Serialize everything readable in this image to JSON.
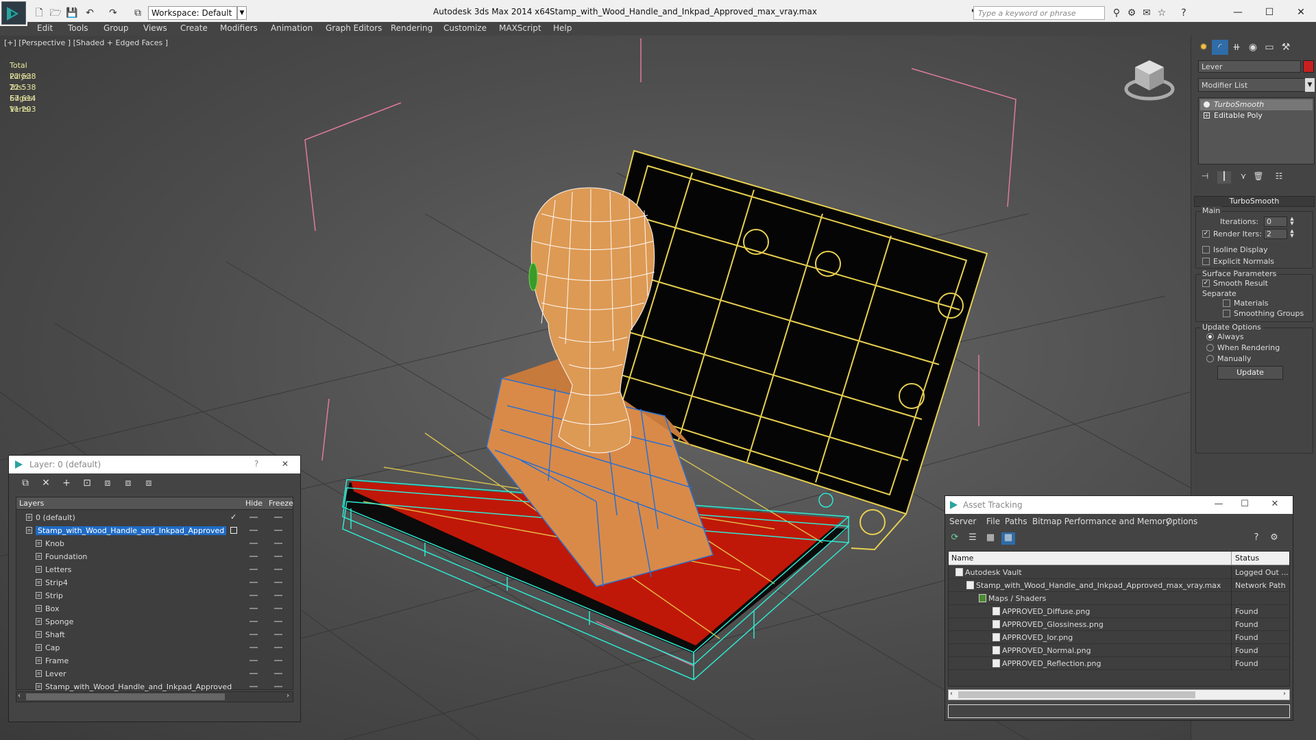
{
  "titlebar": {
    "workspace_label": "Workspace: Default",
    "app_title": "Autodesk 3ds Max  2014 x64",
    "file_title": "Stamp_with_Wood_Handle_and_Inkpad_Approved_max_vray.max",
    "search_placeholder": "Type a keyword or phrase"
  },
  "menu": [
    "Edit",
    "Tools",
    "Group",
    "Views",
    "Create",
    "Modifiers",
    "Animation",
    "Graph Editors",
    "Rendering",
    "Customize",
    "MAXScript",
    "Help"
  ],
  "viewport": {
    "label": "[+] [Perspective ] [Shaded + Edged Faces ]",
    "stats": {
      "header": "Total",
      "rows": [
        {
          "label": "Polys:",
          "value": "22 538"
        },
        {
          "label": "Tris:",
          "value": "22 538"
        },
        {
          "label": "Edges:",
          "value": "67 614"
        },
        {
          "label": "Verts:",
          "value": "11 293"
        }
      ]
    }
  },
  "command_panel": {
    "object_name": "Lever",
    "object_color": "#c62020",
    "modifier_list": "Modifier List",
    "stack": [
      "TurboSmooth",
      "Editable Poly"
    ],
    "rollout_title": "TurboSmooth",
    "main_group": "Main",
    "iterations_label": "Iterations:",
    "iterations_value": "0",
    "render_iters_label": "Render Iters:",
    "render_iters_value": "2",
    "isoline_label": "Isoline Display",
    "explicit_normals_label": "Explicit Normals",
    "surface_group": "Surface Parameters",
    "smooth_result_label": "Smooth Result",
    "separate_label": "Separate",
    "materials_label": "Materials",
    "smoothing_groups_label": "Smoothing Groups",
    "update_group": "Update Options",
    "always_label": "Always",
    "when_rendering_label": "When Rendering",
    "manually_label": "Manually",
    "update_button": "Update"
  },
  "layer_window": {
    "title": "Layer: 0 (default)",
    "help": "?",
    "close": "✕",
    "col_layers": "Layers",
    "col_hide": "Hide",
    "col_freeze": "Freeze",
    "rows": [
      {
        "name": "0 (default)",
        "level": 1
      },
      {
        "name": "Stamp_with_Wood_Handle_and_Inkpad_Approved",
        "level": 1
      },
      {
        "name": "Knob",
        "level": 2
      },
      {
        "name": "Foundation",
        "level": 2
      },
      {
        "name": "Letters",
        "level": 2
      },
      {
        "name": "Strip4",
        "level": 2
      },
      {
        "name": "Strip",
        "level": 2
      },
      {
        "name": "Box",
        "level": 2
      },
      {
        "name": "Sponge",
        "level": 2
      },
      {
        "name": "Shaft",
        "level": 2
      },
      {
        "name": "Cap",
        "level": 2
      },
      {
        "name": "Frame",
        "level": 2
      },
      {
        "name": "Lever",
        "level": 2
      },
      {
        "name": "Stamp_with_Wood_Handle_and_Inkpad_Approved",
        "level": 2
      }
    ]
  },
  "asset_window": {
    "title": "Asset Tracking",
    "menu": [
      "Server",
      "File",
      "Paths",
      "Bitmap Performance and Memory",
      "Options"
    ],
    "col_name": "Name",
    "col_status": "Status",
    "rows": [
      {
        "name": "Autodesk Vault",
        "status": "Logged Out ..."
      },
      {
        "name": "Stamp_with_Wood_Handle_and_Inkpad_Approved_max_vray.max",
        "status": "Network Path"
      },
      {
        "name": "Maps / Shaders",
        "status": ""
      },
      {
        "name": "APPROVED_Diffuse.png",
        "status": "Found"
      },
      {
        "name": "APPROVED_Glossiness.png",
        "status": "Found"
      },
      {
        "name": "APPROVED_Ior.png",
        "status": "Found"
      },
      {
        "name": "APPROVED_Normal.png",
        "status": "Found"
      },
      {
        "name": "APPROVED_Reflection.png",
        "status": "Found"
      }
    ]
  }
}
